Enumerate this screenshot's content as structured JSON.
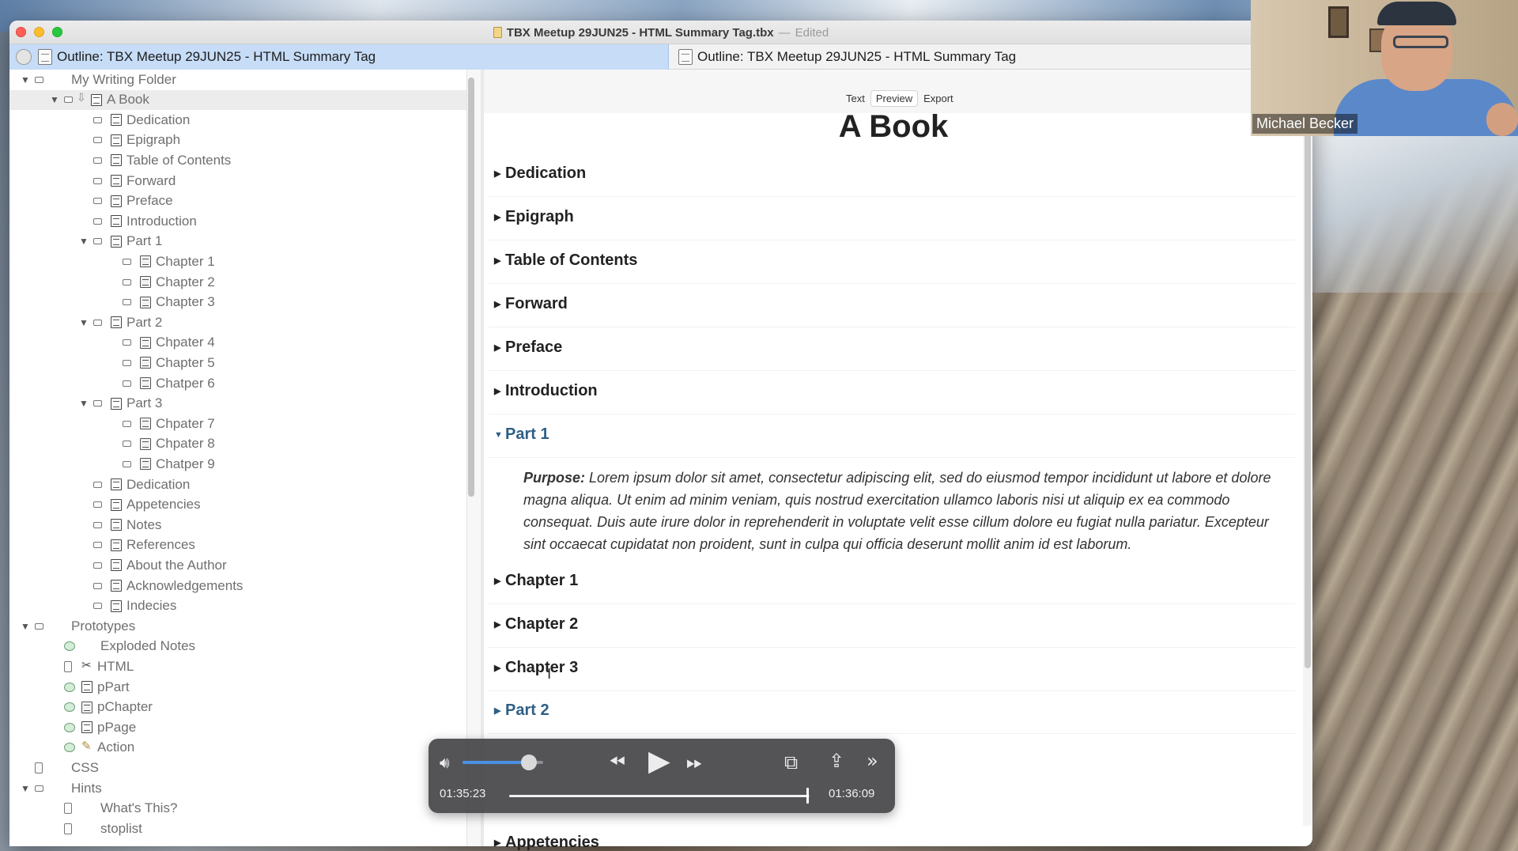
{
  "window": {
    "title": "TBX Meetup 29JUN25 - HTML Summary Tag.tbx",
    "title_separator": "—",
    "status": "Edited"
  },
  "tabs": {
    "left": "Outline: TBX Meetup 29JUN25 - HTML Summary Tag",
    "right": "Outline: TBX Meetup 29JUN25 - HTML Summary Tag"
  },
  "outline": [
    {
      "label": "My Writing Folder",
      "indent": 0,
      "toggle": "expanded",
      "icon": "none",
      "badge": "plain"
    },
    {
      "label": "A Book",
      "indent": 1,
      "toggle": "expanded",
      "icon": "note",
      "badge": "plain",
      "selected": true
    },
    {
      "label": "Dedication",
      "indent": 2,
      "icon": "note",
      "badge": "plain"
    },
    {
      "label": "Epigraph",
      "indent": 2,
      "icon": "note",
      "badge": "plain"
    },
    {
      "label": "Table of Contents",
      "indent": 2,
      "icon": "note",
      "badge": "plain"
    },
    {
      "label": "Forward",
      "indent": 2,
      "icon": "note",
      "badge": "plain"
    },
    {
      "label": "Preface",
      "indent": 2,
      "icon": "note",
      "badge": "plain"
    },
    {
      "label": "Introduction",
      "indent": 2,
      "icon": "note",
      "badge": "plain"
    },
    {
      "label": "Part 1",
      "indent": 2,
      "toggle": "expanded",
      "icon": "note",
      "badge": "plain"
    },
    {
      "label": "Chapter 1",
      "indent": 3,
      "icon": "chapter",
      "badge": "plain"
    },
    {
      "label": "Chapter 2",
      "indent": 3,
      "icon": "chapter",
      "badge": "plain"
    },
    {
      "label": "Chapter 3",
      "indent": 3,
      "icon": "chapter",
      "badge": "plain"
    },
    {
      "label": "Part 2",
      "indent": 2,
      "toggle": "expanded",
      "icon": "note",
      "badge": "plain"
    },
    {
      "label": "Chpater 4",
      "indent": 3,
      "icon": "chapter",
      "badge": "plain"
    },
    {
      "label": "Chapter 5",
      "indent": 3,
      "icon": "chapter",
      "badge": "plain"
    },
    {
      "label": "Chatper 6",
      "indent": 3,
      "icon": "chapter",
      "badge": "plain"
    },
    {
      "label": "Part 3",
      "indent": 2,
      "toggle": "expanded",
      "icon": "note",
      "badge": "plain"
    },
    {
      "label": "Chpater 7",
      "indent": 3,
      "icon": "chapter",
      "badge": "plain"
    },
    {
      "label": "Chpater 8",
      "indent": 3,
      "icon": "chapter",
      "badge": "plain"
    },
    {
      "label": "Chatper 9",
      "indent": 3,
      "icon": "chapter",
      "badge": "plain"
    },
    {
      "label": "Dedication",
      "indent": 2,
      "icon": "note",
      "badge": "plain"
    },
    {
      "label": "Appetencies",
      "indent": 2,
      "icon": "note",
      "badge": "plain"
    },
    {
      "label": "Notes",
      "indent": 2,
      "icon": "note",
      "badge": "plain"
    },
    {
      "label": "References",
      "indent": 2,
      "icon": "note",
      "badge": "plain"
    },
    {
      "label": "About the Author",
      "indent": 2,
      "icon": "note",
      "badge": "plain"
    },
    {
      "label": "Acknowledgements",
      "indent": 2,
      "icon": "note",
      "badge": "plain"
    },
    {
      "label": "Indecies",
      "indent": 2,
      "icon": "note",
      "badge": "plain"
    },
    {
      "label": "Prototypes",
      "indent": 0,
      "toggle": "expanded",
      "icon": "none",
      "badge": "plain"
    },
    {
      "label": "Exploded Notes",
      "indent": 1,
      "icon": "none",
      "badge": "green"
    },
    {
      "label": "HTML",
      "indent": 1,
      "icon": "tool",
      "badge": "tall"
    },
    {
      "label": "pPart",
      "indent": 1,
      "icon": "note",
      "badge": "green"
    },
    {
      "label": "pChapter",
      "indent": 1,
      "icon": "chapter",
      "badge": "green"
    },
    {
      "label": "pPage",
      "indent": 1,
      "icon": "note",
      "badge": "green"
    },
    {
      "label": "Action",
      "indent": 1,
      "icon": "pen",
      "badge": "green"
    },
    {
      "label": "CSS",
      "indent": 0,
      "icon": "none",
      "badge": "tall"
    },
    {
      "label": "Hints",
      "indent": 0,
      "toggle": "expanded",
      "icon": "none",
      "badge": "plain"
    },
    {
      "label": "What's This?",
      "indent": 1,
      "icon": "none",
      "badge": "tall"
    },
    {
      "label": "stoplist",
      "indent": 1,
      "icon": "none",
      "badge": "tall"
    }
  ],
  "preview": {
    "modes": [
      "Text",
      "Preview",
      "Export"
    ],
    "active_mode": "Preview",
    "heading": "A Book",
    "sections": [
      {
        "label": "Dedication",
        "expanded": false,
        "link": false
      },
      {
        "label": "Epigraph",
        "expanded": false,
        "link": false
      },
      {
        "label": "Table of Contents",
        "expanded": false,
        "link": false
      },
      {
        "label": "Forward",
        "expanded": false,
        "link": false
      },
      {
        "label": "Preface",
        "expanded": false,
        "link": false
      },
      {
        "label": "Introduction",
        "expanded": false,
        "link": false
      },
      {
        "label": "Part 1",
        "expanded": true,
        "link": true
      },
      {
        "label": "Chapter 1",
        "expanded": false,
        "link": false
      },
      {
        "label": "Chapter 2",
        "expanded": false,
        "link": false
      },
      {
        "label": "Chapter 3",
        "expanded": false,
        "link": false
      },
      {
        "label": "Part 2",
        "expanded": false,
        "link": true
      }
    ],
    "purpose_label": "Purpose:",
    "purpose_text": " Lorem ipsum dolor sit amet, consectetur adipiscing elit, sed do eiusmod tempor incididunt ut labore et dolore magna aliqua. Ut enim ad minim veniam, quis nostrud exercitation ullamco laboris nisi ut aliquip ex ea commodo consequat. Duis aute irure dolor in reprehenderit in voluptate velit esse cillum dolore eu fugiat nulla pariatur. Excepteur sint occaecat cupidatat non proident, sunt in culpa qui officia deserunt mollit anim id est laborum.",
    "partial_section": "Appetencies"
  },
  "video_call": {
    "participant_name": "Michael Becker"
  },
  "player": {
    "current_time": "01:35:23",
    "total_time": "01:36:09",
    "progress": 0.992,
    "volume": 0.82,
    "icons": {
      "volume": "speaker-icon",
      "rewind": "rewind-icon",
      "play": "play-icon",
      "forward": "fast-forward-icon",
      "pip": "picture-in-picture-icon",
      "share": "share-icon",
      "more": "more-icon"
    }
  }
}
